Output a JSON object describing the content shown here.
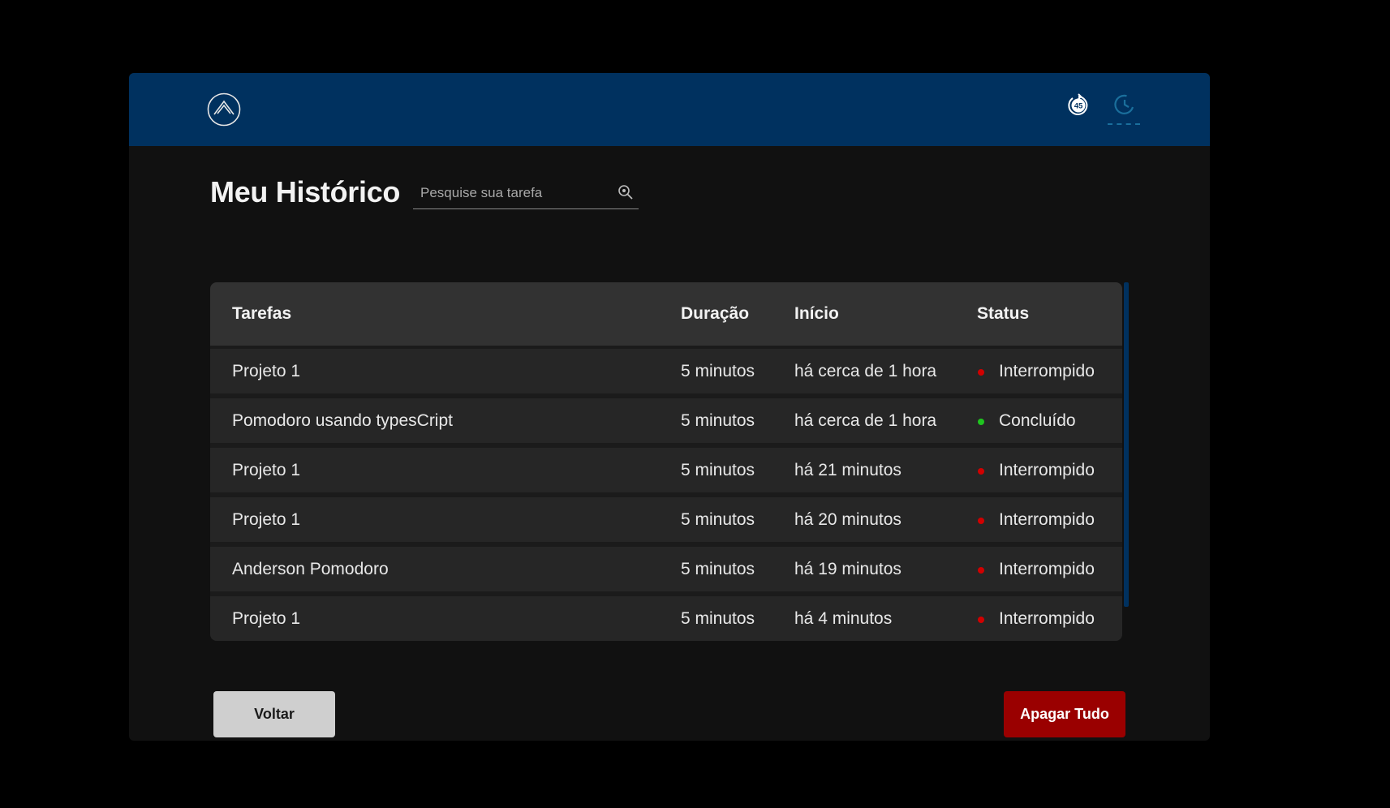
{
  "header": {
    "logo_icon": "triangle-logo-icon",
    "nav": {
      "timer_icon": "timer-45-icon",
      "history_icon": "clock-history-icon",
      "active": "history",
      "active_color": "#1a6f9c"
    },
    "background_color": "#00315f"
  },
  "page": {
    "title": "Meu Histórico"
  },
  "search": {
    "placeholder": "Pesquise sua tarefa",
    "value": "",
    "icon": "magnifier-icon"
  },
  "table": {
    "headers": {
      "task": "Tarefas",
      "duration": "Duração",
      "start": "Início",
      "status": "Status"
    },
    "rows": [
      {
        "task": "Projeto 1",
        "duration": "5 minutos",
        "start": "há cerca de 1 hora",
        "status": "Interrompido",
        "status_color": "#d10000"
      },
      {
        "task": "Pomodoro usando typesCript",
        "duration": "5 minutos",
        "start": "há cerca de 1 hora",
        "status": "Concluído",
        "status_color": "#1fc41f"
      },
      {
        "task": "Projeto 1",
        "duration": "5 minutos",
        "start": "há 21 minutos",
        "status": "Interrompido",
        "status_color": "#d10000"
      },
      {
        "task": "Projeto 1",
        "duration": "5 minutos",
        "start": "há 20 minutos",
        "status": "Interrompido",
        "status_color": "#d10000"
      },
      {
        "task": "Anderson Pomodoro",
        "duration": "5 minutos",
        "start": "há 19 minutos",
        "status": "Interrompido",
        "status_color": "#d10000"
      },
      {
        "task": "Projeto 1",
        "duration": "5 minutos",
        "start": "há 4 minutos",
        "status": "Interrompido",
        "status_color": "#d10000"
      }
    ]
  },
  "actions": {
    "back_label": "Voltar",
    "clear_label": "Apagar Tudo",
    "clear_color": "#9a0000"
  }
}
